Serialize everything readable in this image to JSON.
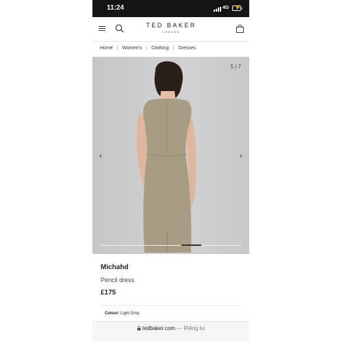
{
  "status_bar": {
    "time": "11:24",
    "network": "4G"
  },
  "header": {
    "brand": "TED BAKER",
    "brand_sub": "LONDON"
  },
  "breadcrumb": [
    "Home",
    "Women's",
    "Clothing",
    "Dresses"
  ],
  "breadcrumb_separator": "|",
  "gallery": {
    "counter": "5 | 7",
    "current": 5,
    "total": 7,
    "prev_glyph": "‹",
    "next_glyph": "›"
  },
  "product": {
    "name": "Michahd",
    "type": "Pencil dress",
    "price": "£175"
  },
  "colour": {
    "label": "Colour:",
    "value": "Light Grey"
  },
  "url_bar": {
    "domain": "tedbaker.com",
    "suffix": " — Riêng tư"
  },
  "colors": {
    "dress": "#a89c84",
    "background": "#cdcdcf",
    "status_bar": "#141414"
  }
}
